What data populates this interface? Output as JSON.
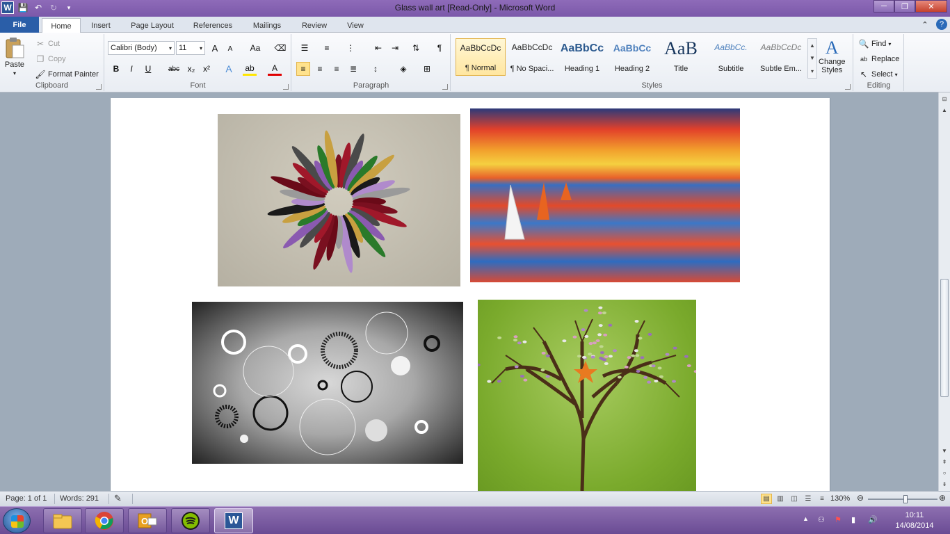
{
  "window": {
    "title": "Glass wall art [Read-Only]  -  Microsoft Word",
    "minimize": "─",
    "restore": "❐",
    "close": "✕"
  },
  "qat": {
    "app": "W"
  },
  "tabs": [
    {
      "label": "File"
    },
    {
      "label": "Home"
    },
    {
      "label": "Insert"
    },
    {
      "label": "Page Layout"
    },
    {
      "label": "References"
    },
    {
      "label": "Mailings"
    },
    {
      "label": "Review"
    },
    {
      "label": "View"
    }
  ],
  "ribbon": {
    "clipboard": {
      "label": "Clipboard",
      "paste": "Paste",
      "cut": "Cut",
      "copy": "Copy",
      "format_painter": "Format Painter"
    },
    "font": {
      "label": "Font",
      "font_name": "Calibri (Body)",
      "font_size": "11",
      "bold": "B",
      "italic": "I",
      "underline": "U",
      "strike": "abc",
      "subscript": "x₂",
      "superscript": "x²",
      "grow": "A",
      "shrink": "A",
      "change_case": "Aa",
      "effects": "A",
      "highlight": "ab",
      "color": "A"
    },
    "paragraph": {
      "label": "Paragraph",
      "pilcrow": "¶"
    },
    "styles": {
      "label": "Styles",
      "items": [
        {
          "sample": "AaBbCcDc",
          "name": "¶ Normal"
        },
        {
          "sample": "AaBbCcDc",
          "name": "¶ No Spaci..."
        },
        {
          "sample": "AaBbCc",
          "name": "Heading 1"
        },
        {
          "sample": "AaBbCc",
          "name": "Heading 2"
        },
        {
          "sample": "AaB",
          "name": "Title"
        },
        {
          "sample": "AaBbCc.",
          "name": "Subtitle"
        },
        {
          "sample": "AaBbCcDc",
          "name": "Subtle Em..."
        }
      ],
      "change_styles_line1": "Change",
      "change_styles_line2": "Styles"
    },
    "editing": {
      "label": "Editing",
      "find": "Find",
      "replace": "Replace",
      "select": "Select"
    }
  },
  "status": {
    "page": "Page: 1 of 1",
    "words": "Words: 291",
    "zoom": "130%",
    "zoom_level_percent": 130
  },
  "taskbar": {
    "time": "10:11",
    "date": "14/08/2014",
    "word_app": "W"
  },
  "colors": {
    "accent": "#2a5ea8",
    "titlebar": "#7b58a9",
    "highlight": "#ffe28c"
  }
}
